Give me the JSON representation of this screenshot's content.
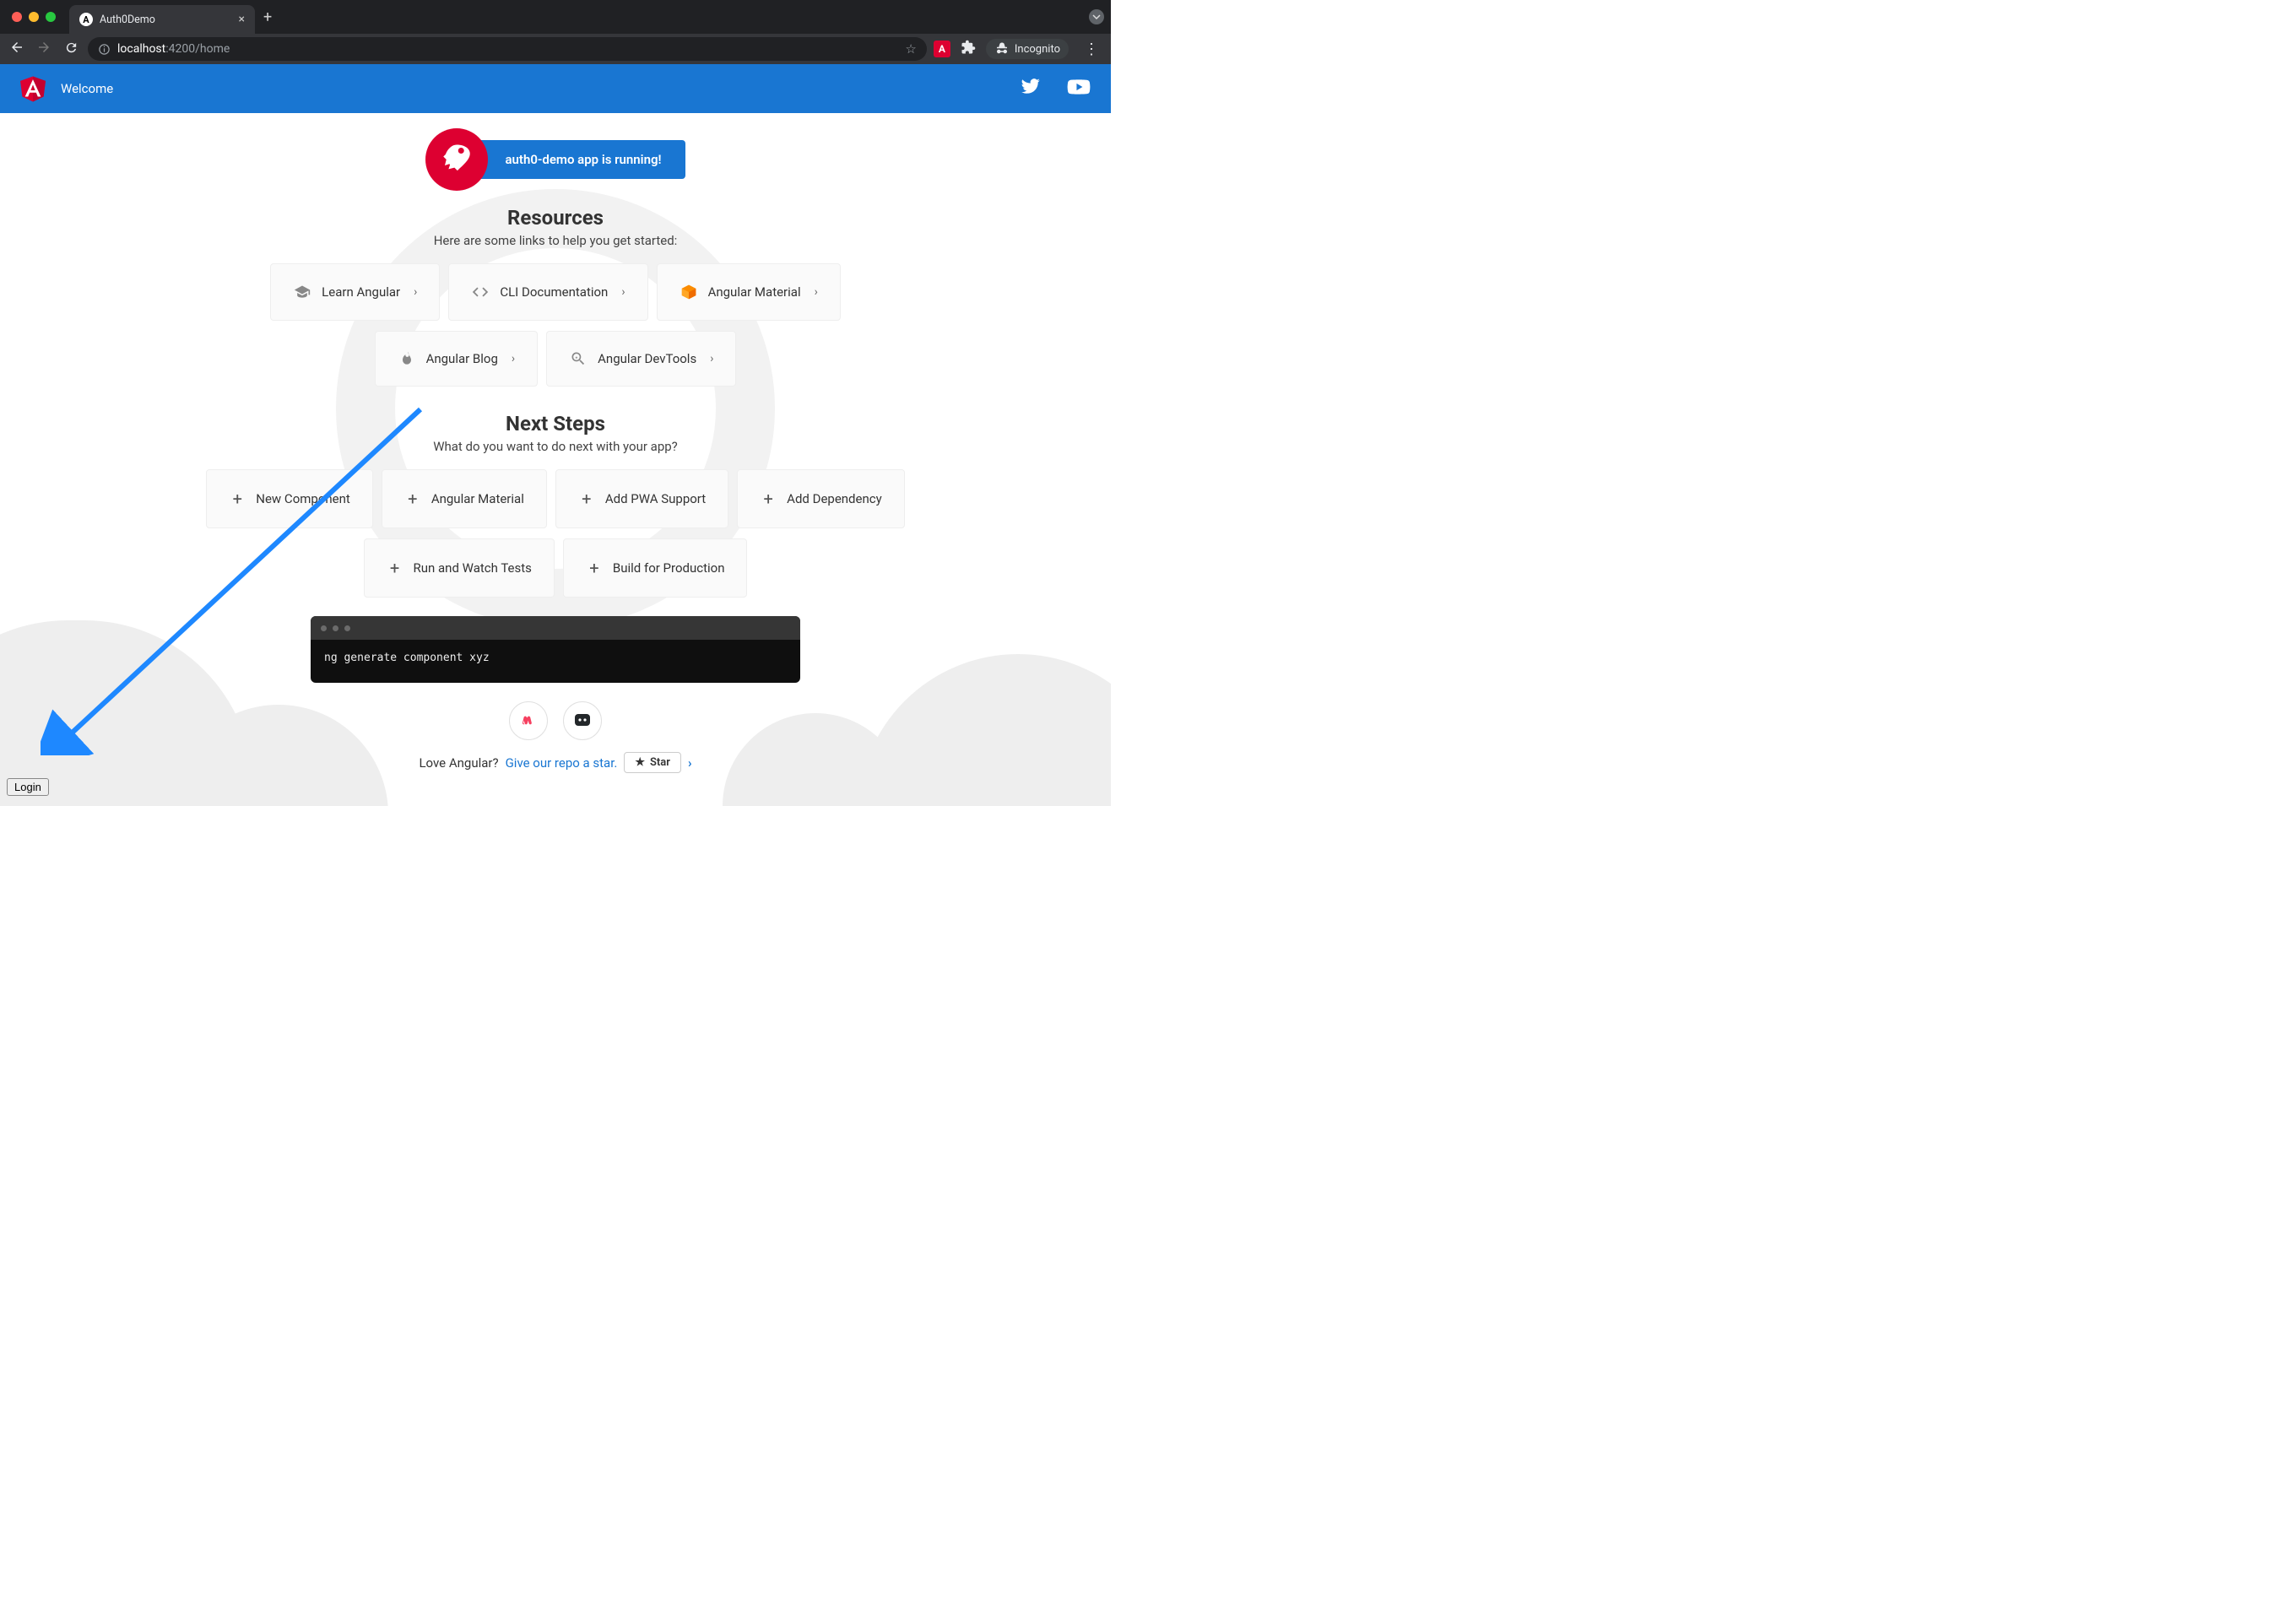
{
  "browser": {
    "tab_title": "Auth0Demo",
    "url_host": "localhost",
    "url_path": ":4200/home",
    "incognito_label": "Incognito"
  },
  "header": {
    "title": "Welcome"
  },
  "hero": {
    "banner": "auth0-demo app is running!"
  },
  "resources": {
    "title": "Resources",
    "subtitle": "Here are some links to help you get started:",
    "cards": [
      {
        "label": "Learn Angular",
        "icon": "graduation-cap-icon"
      },
      {
        "label": "CLI Documentation",
        "icon": "code-icon"
      },
      {
        "label": "Angular Material",
        "icon": "material-icon"
      },
      {
        "label": "Angular Blog",
        "icon": "fire-icon"
      },
      {
        "label": "Angular DevTools",
        "icon": "magnify-icon"
      }
    ]
  },
  "next_steps": {
    "title": "Next Steps",
    "subtitle": "What do you want to do next with your app?",
    "cards": [
      {
        "label": "New Component"
      },
      {
        "label": "Angular Material"
      },
      {
        "label": "Add PWA Support"
      },
      {
        "label": "Add Dependency"
      },
      {
        "label": "Run and Watch Tests"
      },
      {
        "label": "Build for Production"
      }
    ]
  },
  "terminal": {
    "command": "ng generate component xyz"
  },
  "footer": {
    "love_prefix": "Love Angular?",
    "love_link": "Give our repo a star.",
    "star_label": "Star"
  },
  "login": {
    "label": "Login"
  }
}
